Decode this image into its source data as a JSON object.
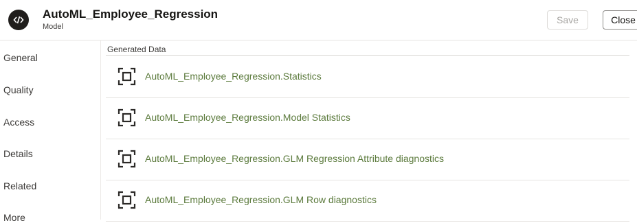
{
  "header": {
    "icon": "code-icon",
    "title": "AutoML_Employee_Regression",
    "subtitle": "Model",
    "save_label": "Save",
    "close_label": "Close"
  },
  "sidebar": {
    "items": [
      {
        "label": "General"
      },
      {
        "label": "Quality"
      },
      {
        "label": "Access"
      },
      {
        "label": "Details"
      },
      {
        "label": "Related"
      },
      {
        "label": "More"
      }
    ]
  },
  "main": {
    "section_label": "Generated Data",
    "items": [
      {
        "label": "AutoML_Employee_Regression.Statistics",
        "icon": "table-data-icon"
      },
      {
        "label": "AutoML_Employee_Regression.Model Statistics",
        "icon": "table-data-icon"
      },
      {
        "label": "AutoML_Employee_Regression.GLM Regression Attribute diagnostics",
        "icon": "table-data-icon"
      },
      {
        "label": "AutoML_Employee_Regression.GLM Row diagnostics",
        "icon": "table-data-icon"
      }
    ]
  },
  "colors": {
    "link": "#5b7a3c",
    "icon_bg": "#201e1c",
    "text": "#161513"
  }
}
